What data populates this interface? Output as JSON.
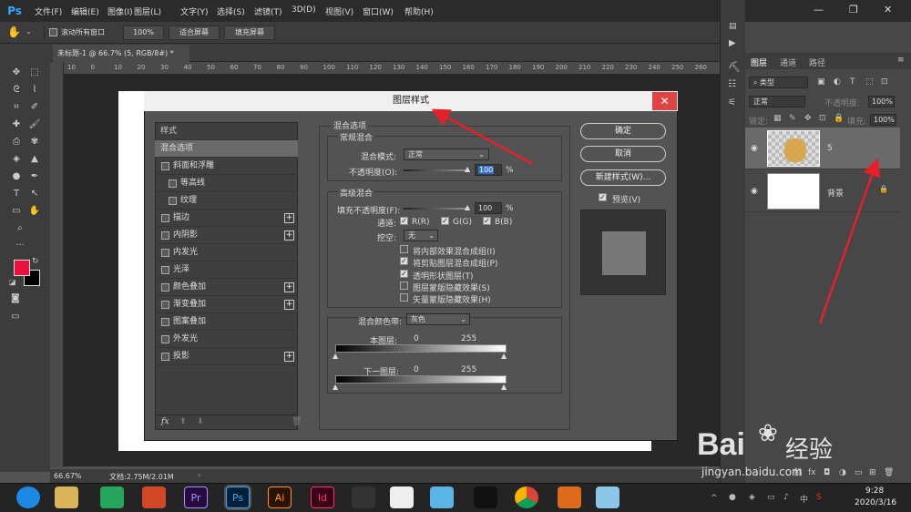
{
  "app": {
    "logo": "Ps"
  },
  "menu": [
    "文件(F)",
    "编辑(E)",
    "图像(I)",
    "图层(L)",
    "文字(Y)",
    "选择(S)",
    "滤镜(T)",
    "3D(D)",
    "视图(V)",
    "窗口(W)",
    "帮助(H)"
  ],
  "options": {
    "scroll_all": "滚动所有窗口",
    "zoom": "100%",
    "fit_screen": "适合屏幕",
    "fill_screen": "填充屏幕"
  },
  "document_tab": "未标题-1 @ 66.7% (5, RGB/8#) *",
  "ruler_marks": [
    "10",
    "0",
    "10",
    "20",
    "30",
    "40",
    "50",
    "60",
    "70",
    "80",
    "90",
    "100",
    "110",
    "120",
    "130",
    "140",
    "150",
    "160",
    "170",
    "180",
    "190",
    "200",
    "210",
    "220",
    "230",
    "240",
    "250",
    "260"
  ],
  "status": {
    "zoom": "66.67%",
    "doc": "文档:2.75M/2.01M"
  },
  "colors": {
    "foreground": "#e8103f",
    "background": "#000000"
  },
  "layers_panel": {
    "tabs": [
      "图层",
      "通道",
      "路径"
    ],
    "kind": "类型",
    "blend": "正常",
    "opacity_label": "不透明度:",
    "opacity": "100%",
    "lock_label": "锁定:",
    "fill_label": "填充:",
    "fill": "100%",
    "layers": [
      {
        "name": "5"
      },
      {
        "name": "背景"
      }
    ]
  },
  "dialog": {
    "title": "图层样式",
    "styles_header": "样式",
    "styles": [
      {
        "label": "混合选项",
        "active": true
      },
      {
        "label": "斜面和浮雕",
        "checkbox": true
      },
      {
        "label": "等高线",
        "checkbox": true,
        "indent": true
      },
      {
        "label": "纹理",
        "checkbox": true,
        "indent": true
      },
      {
        "label": "描边",
        "checkbox": true,
        "plus": true
      },
      {
        "label": "内阴影",
        "checkbox": true,
        "plus": true
      },
      {
        "label": "内发光",
        "checkbox": true
      },
      {
        "label": "光泽",
        "checkbox": true
      },
      {
        "label": "颜色叠加",
        "checkbox": true,
        "plus": true
      },
      {
        "label": "渐变叠加",
        "checkbox": true,
        "plus": true
      },
      {
        "label": "图案叠加",
        "checkbox": true
      },
      {
        "label": "外发光",
        "checkbox": true
      },
      {
        "label": "投影",
        "checkbox": true,
        "plus": true
      }
    ],
    "footer_fx": "fx",
    "blend_options": "混合选项",
    "general": {
      "title": "常规混合",
      "mode_label": "混合模式:",
      "mode": "正常",
      "opacity_label": "不透明度(O):",
      "opacity": "100",
      "unit": "%"
    },
    "advanced": {
      "title": "高级混合",
      "fill_label": "填充不透明度(F):",
      "fill": "100",
      "unit": "%",
      "channels_label": "通道:",
      "r": "R(R)",
      "g": "G(G)",
      "b": "B(B)",
      "knockout_label": "挖空:",
      "knockout": "无",
      "options": [
        {
          "label": "将内部效果混合成组(I)",
          "checked": false
        },
        {
          "label": "将剪贴图层混合成组(P)",
          "checked": true
        },
        {
          "label": "透明形状图层(T)",
          "checked": true
        },
        {
          "label": "图层蒙版隐藏效果(S)",
          "checked": false
        },
        {
          "label": "矢量蒙版隐藏效果(H)",
          "checked": false
        }
      ]
    },
    "blend_if": {
      "label": "混合颜色带:",
      "value": "灰色",
      "this_layer": "本图层:",
      "underlying": "下一图层:",
      "min": "0",
      "max": "255"
    },
    "buttons": {
      "ok": "确定",
      "cancel": "取消",
      "new_style": "新建样式(W)...",
      "preview": "预览(V)"
    }
  },
  "taskbar": {
    "time": "9:28",
    "date": "2020/3/16"
  },
  "watermark": {
    "brand": "Bai",
    "brand2": "经验",
    "url": "jingyan.baidu.com"
  }
}
